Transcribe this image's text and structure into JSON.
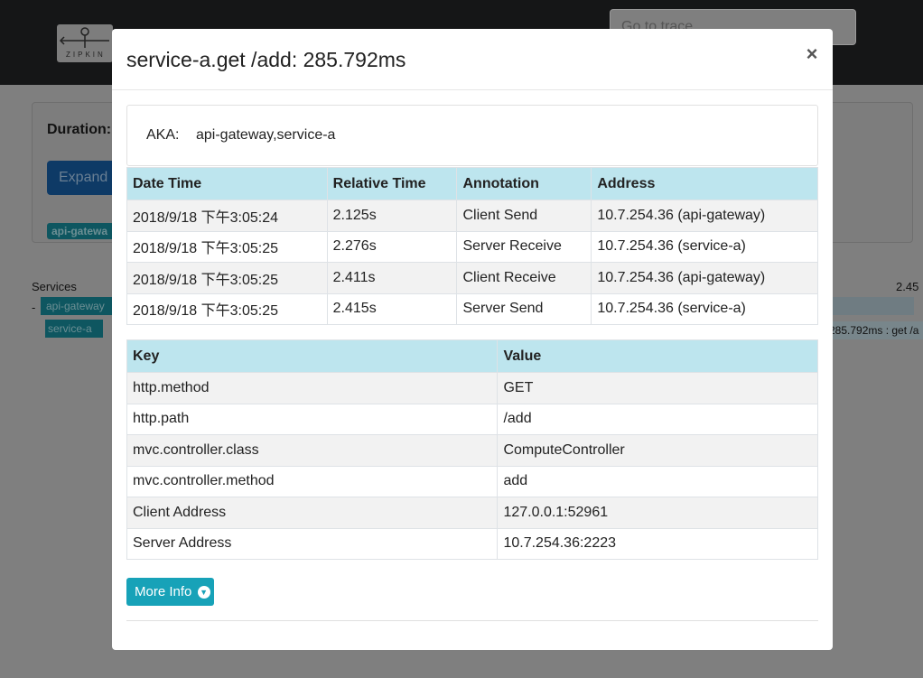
{
  "background": {
    "logo_text": "ZIPKIN",
    "goto_placeholder": "Go to trace",
    "duration_label": "Duration:",
    "expand_label": "Expand",
    "badge_top": "api-gatewa",
    "services_label": "Services",
    "dash": "-",
    "service_1": "api-gateway",
    "service_2": "service-a",
    "right_time": "2.45",
    "right_span": "285.792ms : get /a"
  },
  "modal": {
    "title": "service-a.get /add: 285.792ms",
    "close_symbol": "×",
    "aka_label": "AKA:",
    "aka_value": "api-gateway,service-a",
    "annotations": {
      "headers": [
        "Date Time",
        "Relative Time",
        "Annotation",
        "Address"
      ],
      "rows": [
        [
          "2018/9/18 下午3:05:24",
          "2.125s",
          "Client Send",
          "10.7.254.36 (api-gateway)"
        ],
        [
          "2018/9/18 下午3:05:25",
          "2.276s",
          "Server Receive",
          "10.7.254.36 (service-a)"
        ],
        [
          "2018/9/18 下午3:05:25",
          "2.411s",
          "Client Receive",
          "10.7.254.36 (api-gateway)"
        ],
        [
          "2018/9/18 下午3:05:25",
          "2.415s",
          "Server Send",
          "10.7.254.36 (service-a)"
        ]
      ]
    },
    "tags": {
      "headers": [
        "Key",
        "Value"
      ],
      "rows": [
        [
          "http.method",
          "GET"
        ],
        [
          "http.path",
          "/add"
        ],
        [
          "mvc.controller.class",
          "ComputeController"
        ],
        [
          "mvc.controller.method",
          "add"
        ],
        [
          "Client Address",
          "127.0.0.1:52961"
        ],
        [
          "Server Address",
          "10.7.254.36:2223"
        ]
      ]
    },
    "more_info_label": "More Info",
    "more_info_icon": "chevron-down-circle-icon"
  }
}
